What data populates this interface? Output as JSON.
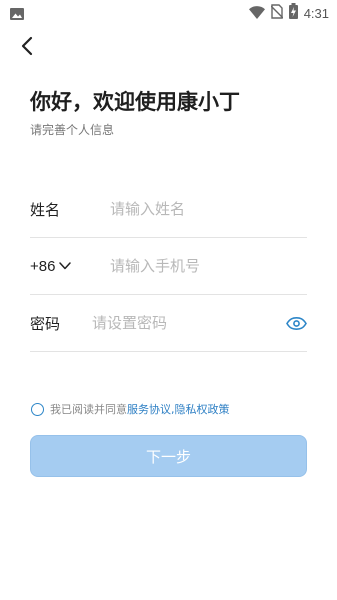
{
  "status_bar": {
    "time": "4:31",
    "icons": [
      "image-icon",
      "wifi-icon",
      "no-sim-icon",
      "battery-charging-icon"
    ]
  },
  "header": {
    "back_icon": "chevron-left-icon",
    "title": "你好，欢迎使用康小丁",
    "subtitle": "请完善个人信息"
  },
  "form": {
    "name": {
      "label": "姓名",
      "placeholder": "请输入姓名",
      "value": ""
    },
    "phone": {
      "country_code": "+86",
      "placeholder": "请输入手机号",
      "value": ""
    },
    "password": {
      "label": "密码",
      "placeholder": "请设置密码",
      "value": "",
      "eye_icon": "eye-icon"
    }
  },
  "agreement": {
    "prefix": "我已阅读并同意",
    "service_link": "服务协议",
    "separator": ",",
    "privacy_link": "隐私权政策",
    "checked": false
  },
  "next_button": {
    "label": "下一步",
    "enabled": false
  },
  "colors": {
    "accent": "#2d7fc4",
    "button_disabled": "#a5ccf1",
    "placeholder": "#b8b8b8",
    "divider": "#e3e3e3"
  }
}
